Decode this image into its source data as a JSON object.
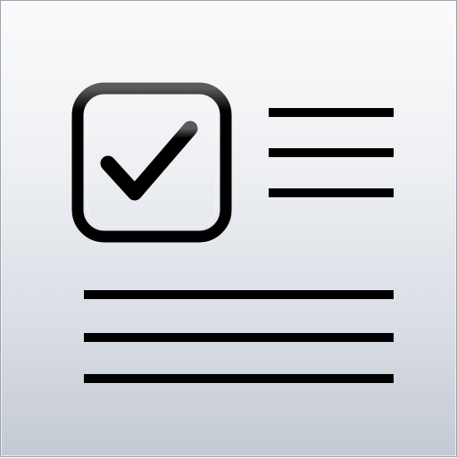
{
  "icon": {
    "name": "checklist-document-icon",
    "checkbox_state": "checked",
    "colors": {
      "background_top": "#fbfbfc",
      "background_bottom": "#c4cad3",
      "glyph": "#000000",
      "border": "#9ea3aa"
    }
  }
}
